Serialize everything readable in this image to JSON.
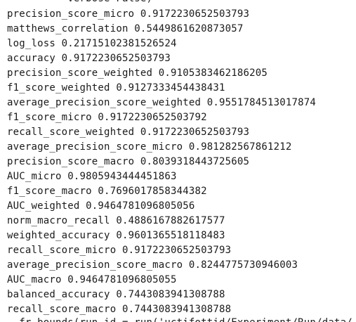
{
  "output": {
    "top_partial": "          verbose=False)",
    "lines": [
      "precision_score_micro 0.9172230652503793",
      "matthews_correlation 0.5449861620873057",
      "log_loss 0.21715102381526524",
      "accuracy 0.9172230652503793",
      "precision_score_weighted 0.9105383462186205",
      "f1_score_weighted 0.9127333454438431",
      "average_precision_score_weighted 0.9551784513017874",
      "f1_score_micro 0.9172230652503792",
      "recall_score_weighted 0.9172230652503793",
      "average_precision_score_micro 0.981282567861212",
      "precision_score_macro 0.8039318443725605",
      "AUC_micro 0.9805943444451863",
      "f1_score_macro 0.7696017858344382",
      "AUC_weighted 0.9464781096805056",
      "norm_macro_recall 0.4886167882617577",
      "weighted_accuracy 0.9601365518118483",
      "recall_score_micro 0.9172230652503793",
      "average_precision_score_macro 0.8244775730946003",
      "AUC_macro 0.9464781096805055",
      "balanced_accuracy 0.7443083941308788",
      "recall_score_macro 0.7443083941308788"
    ],
    "bottom_partial": "  fr_bounds(run_id = run('uctifottid/Experiment/Run/data/"
  }
}
